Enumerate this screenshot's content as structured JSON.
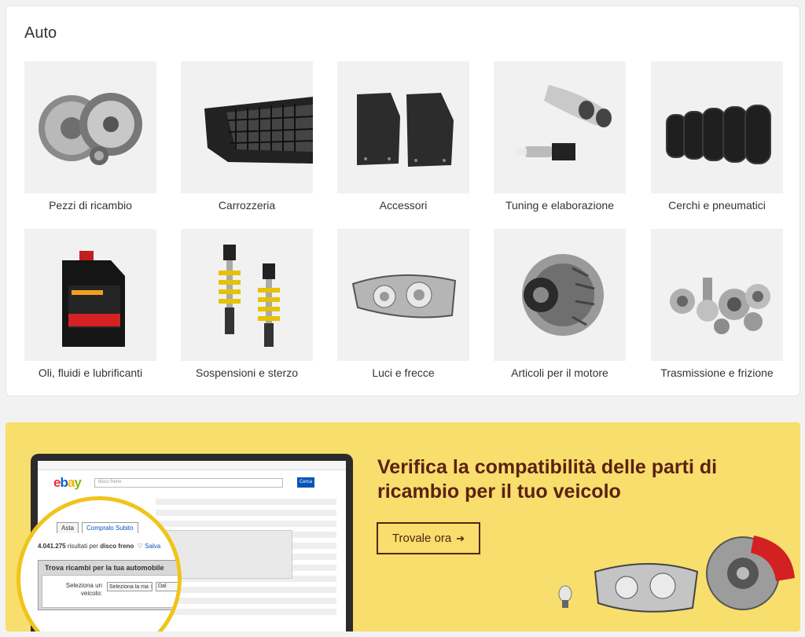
{
  "section": {
    "title": "Auto",
    "categories": [
      {
        "label": "Pezzi di ricambio",
        "icon": "clutch-kit-image"
      },
      {
        "label": "Carrozzeria",
        "icon": "front-bumper-image"
      },
      {
        "label": "Accessori",
        "icon": "floor-mats-image"
      },
      {
        "label": "Tuning e elaborazione",
        "icon": "exhaust-tips-image"
      },
      {
        "label": "Cerchi e pneumatici",
        "icon": "tires-image"
      },
      {
        "label": "Oli, fluidi e lubrificanti",
        "icon": "oil-can-image"
      },
      {
        "label": "Sospensioni e sterzo",
        "icon": "coilovers-image"
      },
      {
        "label": "Luci e frecce",
        "icon": "headlight-image"
      },
      {
        "label": "Articoli per il motore",
        "icon": "alternator-image"
      },
      {
        "label": "Trasmissione e frizione",
        "icon": "bearings-image"
      }
    ]
  },
  "banner": {
    "title": "Verifica la compatibilità delle parti di ricambio per il tuo veicolo",
    "button_label": "Trovale ora",
    "button_arrow": "➔",
    "background_color": "#f7de6d",
    "text_color": "#5b2113",
    "screen": {
      "logo": [
        "e",
        "b",
        "a",
        "y"
      ],
      "search_placeholder": "disco freno",
      "search_button": "Cerca",
      "tabs": [
        "Asta",
        "Compralo Subito"
      ],
      "results_count": "4.041.275",
      "results_text": "risultati per",
      "results_query": "disco freno",
      "finder_title": "Trova ricambi per la tua automobile",
      "select_label": "Seleziona un veicolo:",
      "select_value": "Seleziona la ma",
      "select2_value": "Dal",
      "save_text": "Salva"
    }
  },
  "colors": {
    "accent_yellow": "#f0c419",
    "ebay_red": "#e53238",
    "ebay_blue": "#0064d2",
    "ebay_yellow": "#f5af02",
    "ebay_green": "#86b817"
  }
}
